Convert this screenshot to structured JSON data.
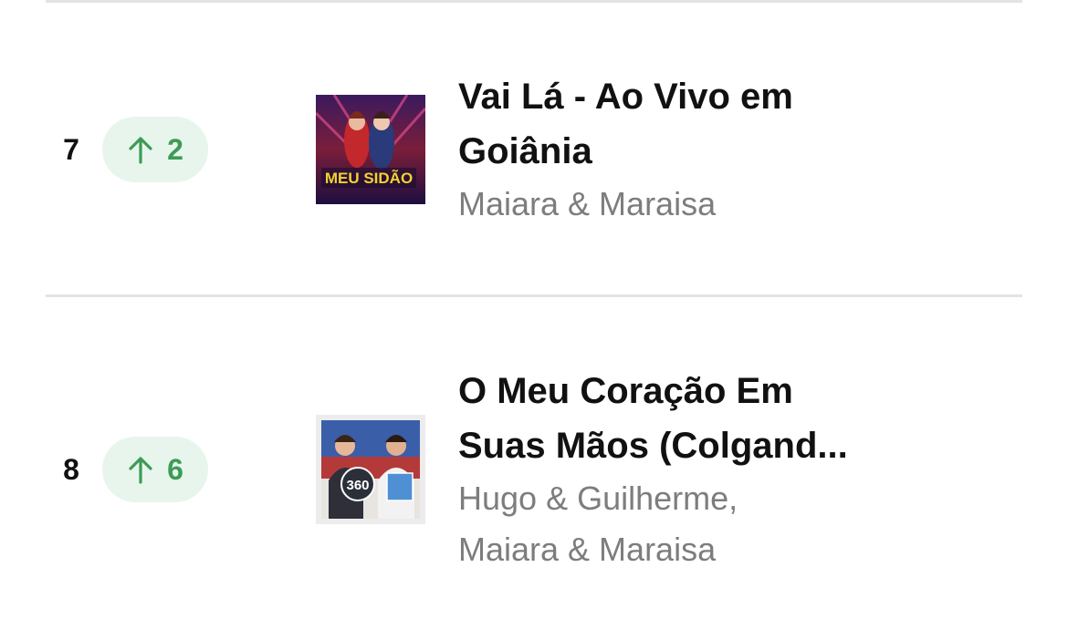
{
  "colors": {
    "badge_bg": "#e8f5ec",
    "badge_fg": "#3d9b57",
    "title": "#111111",
    "artist": "#7d7d7d"
  },
  "rows": [
    {
      "rank": "7",
      "movement": {
        "direction": "up",
        "icon": "arrow-up-icon",
        "value": "2"
      },
      "title_line1": "Vai Lá - Ao Vivo em",
      "title_line2": "Goiânia",
      "artist_line1": "Maiara & Maraisa",
      "artist_line2": "",
      "cover_text": "MEU SIDÃO"
    },
    {
      "rank": "8",
      "movement": {
        "direction": "up",
        "icon": "arrow-up-icon",
        "value": "6"
      },
      "title_line1": "O Meu Coração Em",
      "title_line2": "Suas Mãos (Colgand...",
      "artist_line1": "Hugo & Guilherme,",
      "artist_line2": "Maiara & Maraisa",
      "cover_text": "360"
    }
  ]
}
